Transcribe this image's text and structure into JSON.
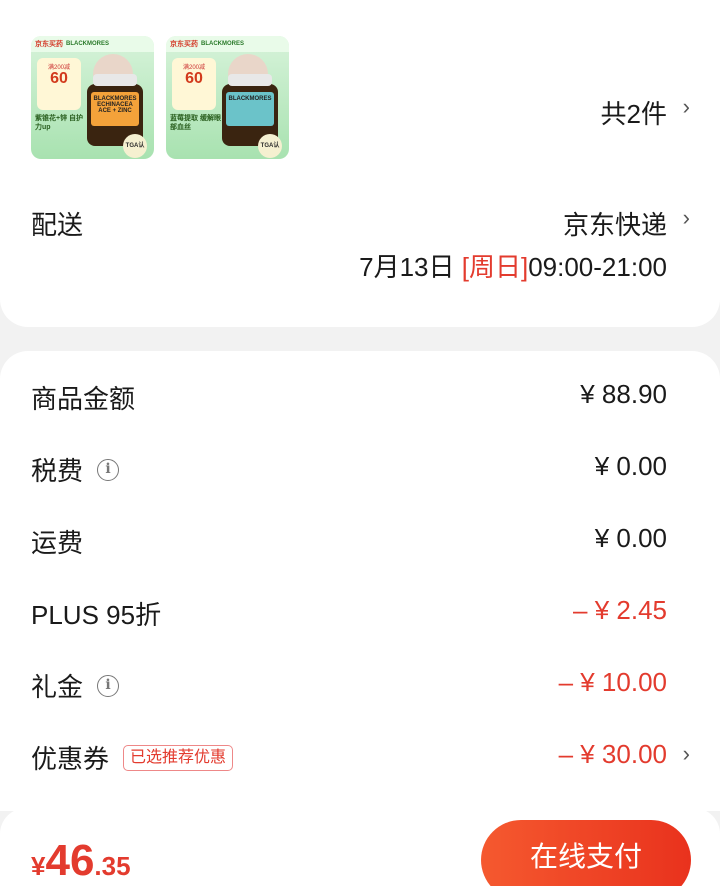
{
  "products": {
    "count_text": "共2件",
    "items": [
      {
        "store_logo": "京东买药",
        "brand_tag": "BLACKMORES",
        "promo_top": "满200减",
        "promo_value": "60",
        "caption": "紫锥花+锌 自护力up",
        "bottle_label": "BLACKMORES ECHINACEA ACE + ZINC",
        "seal": "TGA认证"
      },
      {
        "store_logo": "京东买药",
        "brand_tag": "BLACKMORES",
        "promo_top": "满200减",
        "promo_value": "60",
        "caption": "蓝莓提取 缓解眼部血丝",
        "bottle_label": "BLACKMORES",
        "seal": "TGA认证"
      }
    ]
  },
  "delivery": {
    "label": "配送",
    "courier": "京东快递",
    "date": "7月13日",
    "day": "[周日]",
    "time": "09:00-21:00"
  },
  "price_breakdown": [
    {
      "label": "商品金额",
      "value": "¥ 88.90"
    },
    {
      "label": "税费",
      "value": "¥ 0.00"
    },
    {
      "label": "运费",
      "value": "¥ 0.00"
    },
    {
      "label": "PLUS 95折",
      "value": "– ¥ 2.45"
    },
    {
      "label": "礼金",
      "value": "– ¥ 10.00"
    },
    {
      "label": "优惠券",
      "badge": "已选推荐优惠",
      "value": "– ¥ 30.00"
    }
  ],
  "footer": {
    "currency": "¥",
    "total_int": "46",
    "total_dec": ".35",
    "pay_label": "在线支付"
  },
  "colors": {
    "accent_red": "#e33b2e",
    "pay_gradient_start": "#f5592f",
    "pay_gradient_end": "#e9321d",
    "page_bg": "#f2f2f2"
  }
}
